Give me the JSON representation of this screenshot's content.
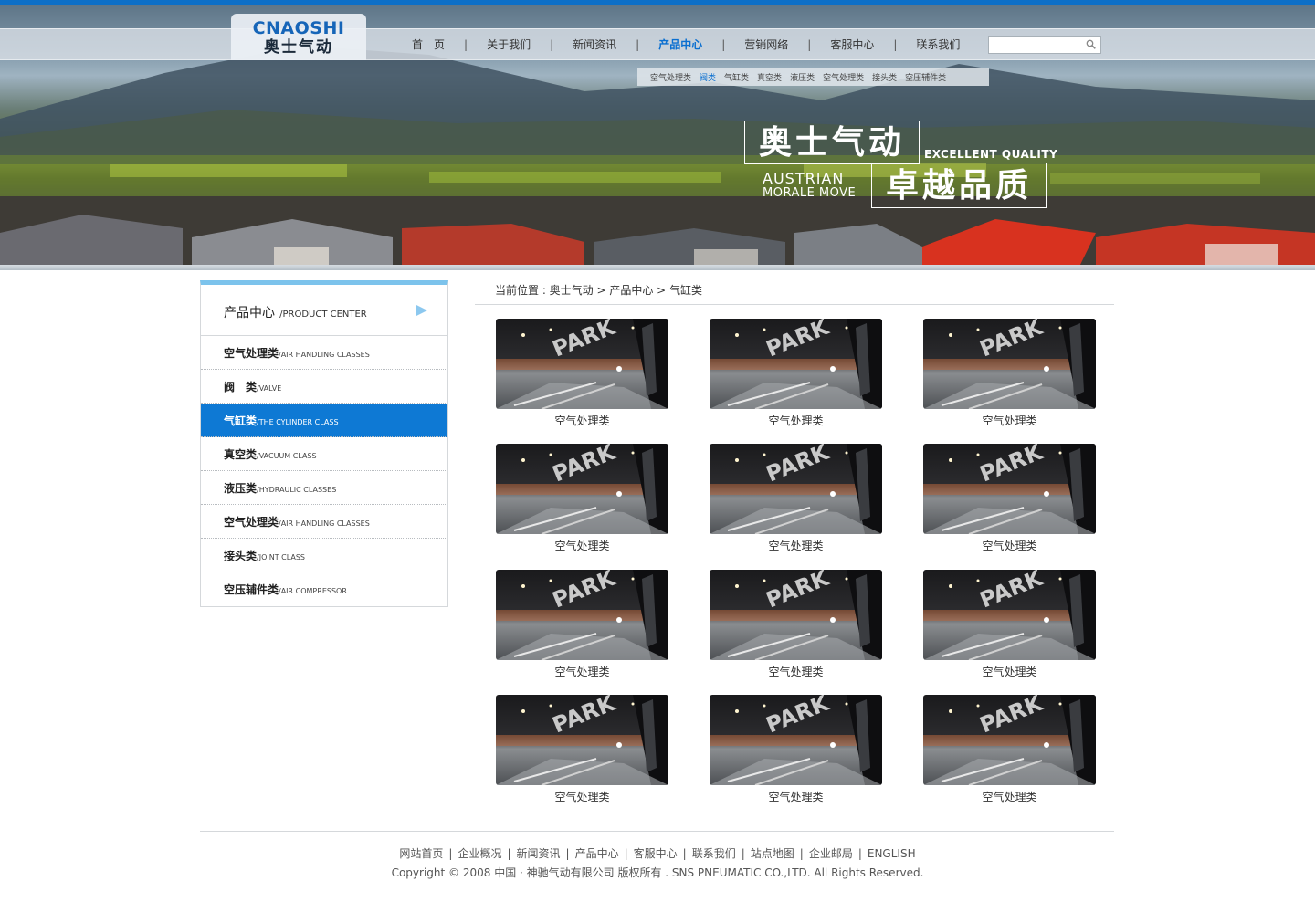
{
  "header": {
    "logo_en": "CNAOSHI",
    "logo_cn": "奥士气动",
    "nav": [
      {
        "label": "首　页",
        "active": false
      },
      {
        "label": "关于我们",
        "active": false
      },
      {
        "label": "新闻资讯",
        "active": false
      },
      {
        "label": "产品中心",
        "active": true
      },
      {
        "label": "营销网络",
        "active": false
      },
      {
        "label": "客服中心",
        "active": false
      },
      {
        "label": "联系我们",
        "active": false
      }
    ],
    "nav_separator": "|",
    "search_value": "",
    "subnav": [
      {
        "label": "空气处理类",
        "active": false
      },
      {
        "label": "阀类",
        "active": true
      },
      {
        "label": "气缸类",
        "active": false
      },
      {
        "label": "真空类",
        "active": false
      },
      {
        "label": "液压类",
        "active": false
      },
      {
        "label": "空气处理类",
        "active": false
      },
      {
        "label": "接头类",
        "active": false
      },
      {
        "label": "空压辅件类",
        "active": false
      }
    ]
  },
  "banner": {
    "slogan_cn_1": "奥士气动",
    "slogan_cn_2": "卓越品质",
    "slogan_en_1": "EXCELLENT QUALITY",
    "slogan_en_2": "AUSTRIAN",
    "slogan_en_3": "MORALE MOVE"
  },
  "sidebar": {
    "title_cn": "产品中心",
    "title_en": "/PRODUCT CENTER",
    "items": [
      {
        "cn": "空气处理类",
        "en": "/AIR HANDLING CLASSES",
        "active": false
      },
      {
        "cn": "阀　类",
        "en": "/VALVE",
        "active": false
      },
      {
        "cn": "气缸类",
        "en": "/THE CYLINDER CLASS",
        "active": true
      },
      {
        "cn": "真空类",
        "en": "/VACUUM CLASS",
        "active": false
      },
      {
        "cn": "液压类",
        "en": "/HYDRAULIC CLASSES",
        "active": false
      },
      {
        "cn": "空气处理类",
        "en": "/AIR HANDLING CLASSES",
        "active": false
      },
      {
        "cn": "接头类",
        "en": "/JOINT CLASS",
        "active": false
      },
      {
        "cn": "空压辅件类",
        "en": "/AIR COMPRESSOR",
        "active": false
      }
    ]
  },
  "breadcrumb": "当前位置 : 奥士气动 > 产品中心 > 气缸类",
  "products": [
    {
      "caption": "空气处理类",
      "image_text": "PARK"
    },
    {
      "caption": "空气处理类",
      "image_text": "PARK"
    },
    {
      "caption": "空气处理类",
      "image_text": "PARK"
    },
    {
      "caption": "空气处理类",
      "image_text": "PARK"
    },
    {
      "caption": "空气处理类",
      "image_text": "PARK"
    },
    {
      "caption": "空气处理类",
      "image_text": "PARK"
    },
    {
      "caption": "空气处理类",
      "image_text": "PARK"
    },
    {
      "caption": "空气处理类",
      "image_text": "PARK"
    },
    {
      "caption": "空气处理类",
      "image_text": "PARK"
    },
    {
      "caption": "空气处理类",
      "image_text": "PARK"
    },
    {
      "caption": "空气处理类",
      "image_text": "PARK"
    },
    {
      "caption": "空气处理类",
      "image_text": "PARK"
    }
  ],
  "footer": {
    "links": [
      "网站首页",
      "企业概况",
      "新闻资讯",
      "产品中心",
      "客服中心",
      "联系我们",
      "站点地图",
      "企业邮局",
      "ENGLISH"
    ],
    "separator": "|",
    "copyright": "Copyright © 2008 中国 · 神驰气动有限公司 版权所有 . SNS PNEUMATIC CO.,LTD. All Rights Reserved."
  },
  "colors": {
    "accent": "#0e79d4",
    "top_bar": "#0d6fc7",
    "sidebar_top": "#7cc3ec"
  }
}
